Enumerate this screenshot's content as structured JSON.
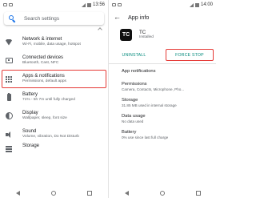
{
  "left_screen": {
    "status_bar": {
      "time": "13:56"
    },
    "search": {
      "placeholder": "Search settings"
    },
    "items": [
      {
        "title": "Network & internet",
        "subtitle": "Wi-Fi, mobile, data usage, hotspot",
        "icon": "wifi-icon"
      },
      {
        "title": "Connected devices",
        "subtitle": "Bluetooth, Cast, NFC",
        "icon": "connected-devices-icon"
      },
      {
        "title": "Apps & notifications",
        "subtitle": "Permissions, default apps",
        "icon": "apps-grid-icon",
        "highlighted": true
      },
      {
        "title": "Battery",
        "subtitle": "71% - 5h 7m until fully charged",
        "icon": "battery-icon"
      },
      {
        "title": "Display",
        "subtitle": "Wallpaper, sleep, font size",
        "icon": "display-icon"
      },
      {
        "title": "Sound",
        "subtitle": "Volume, vibration, Do Not Disturb",
        "icon": "sound-icon"
      },
      {
        "title": "Storage",
        "subtitle": "",
        "icon": "storage-icon"
      }
    ]
  },
  "right_screen": {
    "status_bar": {
      "time": "14:00"
    },
    "title": "App info",
    "app": {
      "icon_text": "TC",
      "name": "TC",
      "status": "Installed"
    },
    "buttons": {
      "uninstall": "UNINSTALL",
      "force_stop": "FORCE STOP"
    },
    "items": [
      {
        "title": "App notifications",
        "subtitle": ""
      },
      {
        "title": "Permissions",
        "subtitle": "Camera, Contacts, Microphone, Pho..."
      },
      {
        "title": "Storage",
        "subtitle": "31.85 MB used in internal storage"
      },
      {
        "title": "Data usage",
        "subtitle": "No data used"
      },
      {
        "title": "Battery",
        "subtitle": "0% use since last full charge"
      }
    ]
  },
  "colors": {
    "accent": "#00897b",
    "highlight": "#e53935",
    "search_icon": "#1a73e8"
  }
}
